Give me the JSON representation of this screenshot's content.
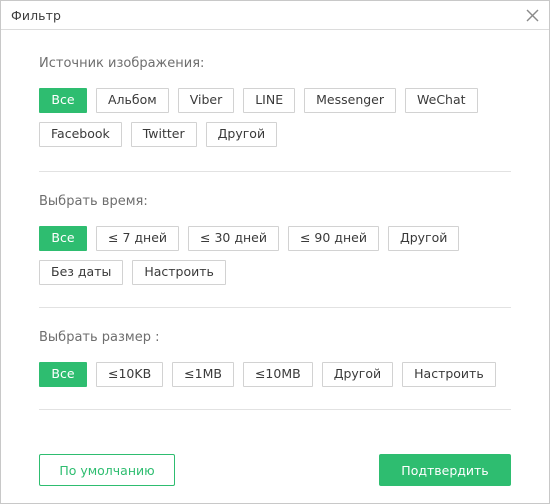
{
  "window": {
    "title": "Фильтр",
    "close_icon": "close-icon"
  },
  "colors": {
    "accent_green": "#2EBD70",
    "border_gray": "#D2D2D2",
    "text_gray": "#6E6E6E"
  },
  "sections": {
    "source": {
      "title": "Источник изображения:",
      "options": [
        {
          "label": "Все",
          "selected": true
        },
        {
          "label": "Альбом",
          "selected": false
        },
        {
          "label": "Viber",
          "selected": false
        },
        {
          "label": "LINE",
          "selected": false
        },
        {
          "label": "Messenger",
          "selected": false
        },
        {
          "label": "WeChat",
          "selected": false
        },
        {
          "label": "Facebook",
          "selected": false
        },
        {
          "label": "Twitter",
          "selected": false
        },
        {
          "label": "Другой",
          "selected": false
        }
      ]
    },
    "time": {
      "title": "Выбрать время:",
      "options": [
        {
          "label": "Все",
          "selected": true
        },
        {
          "label": "≤ 7 дней",
          "selected": false
        },
        {
          "label": "≤ 30 дней",
          "selected": false
        },
        {
          "label": "≤ 90 дней",
          "selected": false
        },
        {
          "label": "Другой",
          "selected": false
        },
        {
          "label": "Без даты",
          "selected": false
        },
        {
          "label": "Настроить",
          "selected": false
        }
      ]
    },
    "size": {
      "title": "Выбрать размер :",
      "options": [
        {
          "label": "Все",
          "selected": true
        },
        {
          "label": "≤10KB",
          "selected": false
        },
        {
          "label": "≤1MB",
          "selected": false
        },
        {
          "label": "≤10MB",
          "selected": false
        },
        {
          "label": "Другой",
          "selected": false
        },
        {
          "label": "Настроить",
          "selected": false
        }
      ]
    }
  },
  "footer": {
    "default_label": "По умолчанию",
    "confirm_label": "Подтвердить"
  }
}
